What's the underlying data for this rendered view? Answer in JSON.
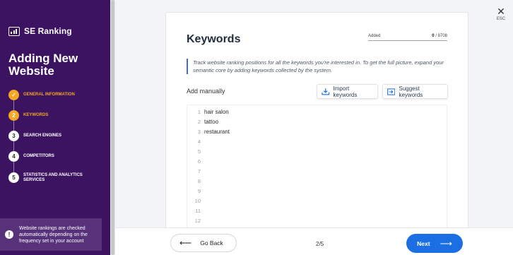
{
  "sidebar": {
    "logo_text": "SE Ranking",
    "title": "Adding New Website",
    "steps": [
      {
        "number": "✓",
        "label": "GENERAL INFORMATION",
        "state": "done"
      },
      {
        "number": "2",
        "label": "KEYWORDS",
        "state": "active"
      },
      {
        "number": "3",
        "label": "SEARCH ENGINES",
        "state": "pending"
      },
      {
        "number": "4",
        "label": "COMPETITORS",
        "state": "pending"
      },
      {
        "number": "5",
        "label": "STATISTICS AND ANALYTICS SERVICES",
        "state": "pending"
      }
    ],
    "note": "Website rankings are checked automatically depending on the frequency set in your account"
  },
  "main": {
    "title": "Keywords",
    "added_label": "Added",
    "added_count": "0",
    "added_limit": "/ 8708",
    "description": "Track website ranking positions for all the keywords you're interested in. To get the full picture, expand your semantic core by adding keywords collected by the system.",
    "add_manually": "Add manually",
    "import_button": "Import keywords",
    "suggest_button": "Suggest keywords",
    "lines": [
      {
        "n": "1",
        "text": "hair salon"
      },
      {
        "n": "2",
        "text": "tattoo"
      },
      {
        "n": "3",
        "text": "restaurant"
      },
      {
        "n": "4",
        "text": ""
      },
      {
        "n": "5",
        "text": ""
      },
      {
        "n": "6",
        "text": ""
      },
      {
        "n": "7",
        "text": ""
      },
      {
        "n": "8",
        "text": ""
      },
      {
        "n": "9",
        "text": ""
      },
      {
        "n": "10",
        "text": ""
      },
      {
        "n": "11",
        "text": ""
      },
      {
        "n": "12",
        "text": ""
      }
    ]
  },
  "footer": {
    "back_label": "Go Back",
    "page": "2/5",
    "next_label": "Next"
  },
  "close": {
    "esc_label": "ESC"
  },
  "colors": {
    "sidebar_bg": "#3c1361",
    "accent_orange": "#f5a623",
    "primary_blue": "#1b6fe3"
  }
}
